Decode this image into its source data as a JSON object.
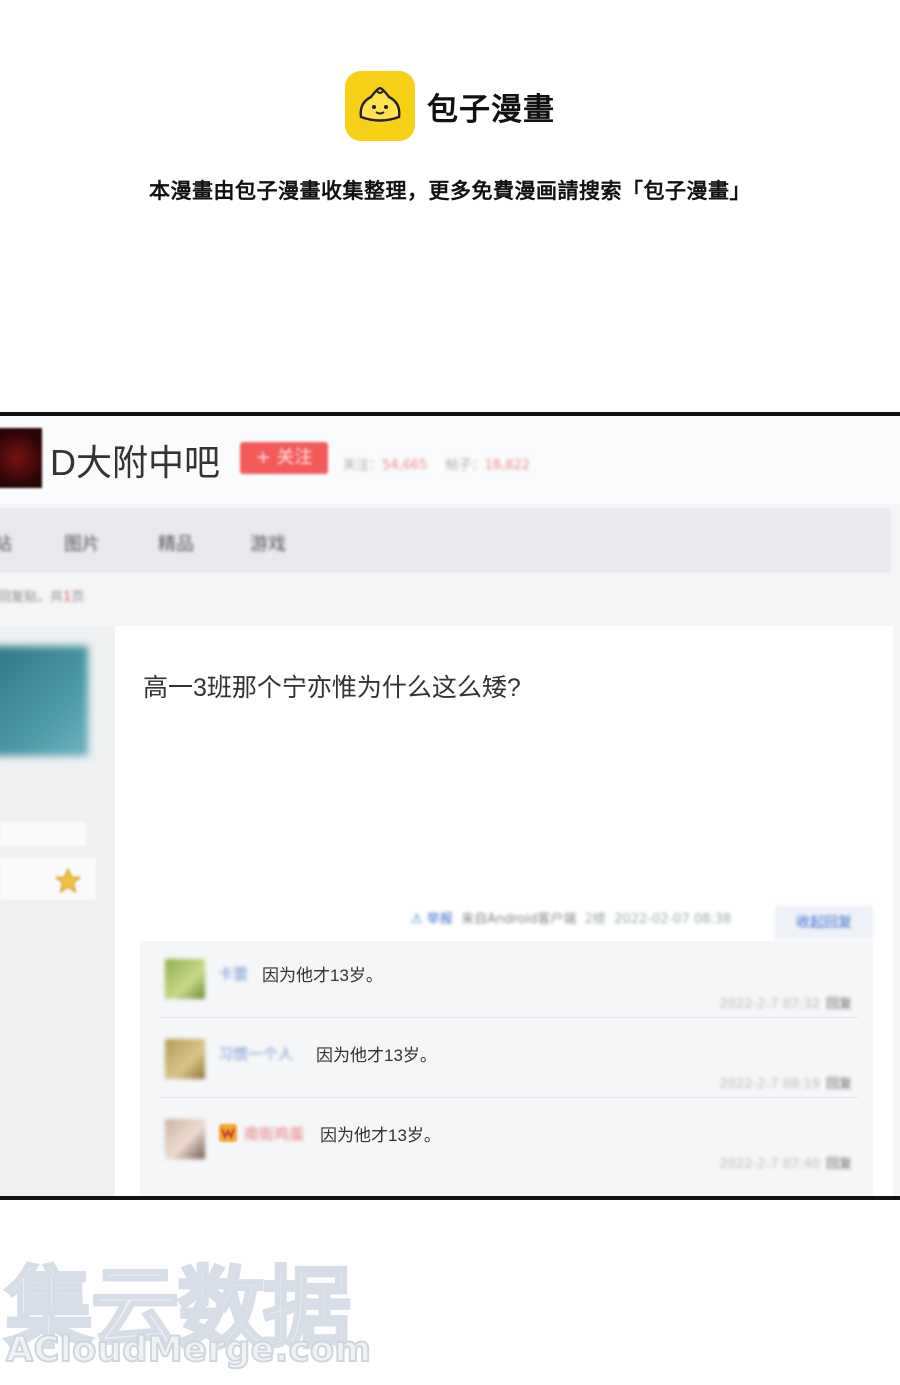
{
  "banner": {
    "brand_name": "包子漫畫",
    "notice": "本漫畫由包子漫畫收集整理，更多免費漫画請搜索「包子漫畫」"
  },
  "forum": {
    "name": "D大附中吧",
    "follow_label": "+ 关注",
    "followers_label": "关注：",
    "followers_value": "54,665",
    "posts_label": "帖子：",
    "posts_value": "18,822"
  },
  "nav": {
    "items": [
      "站",
      "图片",
      "精品",
      "游戏"
    ]
  },
  "breadcrumb": {
    "text_before": "回复贴，共",
    "page_count": "1",
    "text_after": "页"
  },
  "post": {
    "title": "高一3班那个宁亦惟为什么这么矮?",
    "report_label": "举报",
    "client": "来自Android客户端",
    "floor": "2楼",
    "time": "2022-02-07 08:38",
    "collapse_label": "收起回复"
  },
  "replies": [
    {
      "user": "卡蕾",
      "text": "因为他才13岁。",
      "time": "2022-2-7 07:32",
      "reply_label": "回复",
      "user_color": "#7a9ad6"
    },
    {
      "user": "习惯一个人",
      "text": "因为他才13岁。",
      "time": "2022-2-7 08:19",
      "reply_label": "回复",
      "user_color": "#7a9ad6"
    },
    {
      "user": "南街鸡蛋",
      "text": "因为他才13岁。",
      "time": "2022-2-7 07:40",
      "reply_label": "回复",
      "user_color": "#e77777"
    }
  ],
  "watermark": {
    "cn": "集云数据",
    "en": "ACloudMerge.com"
  },
  "colors": {
    "logo_yellow": "#f7d117",
    "follow_red": "#f35b5b",
    "link_blue": "#3a6fcf"
  },
  "icons": [
    "bun-logo-icon",
    "warning-icon",
    "star-badge-icon",
    "vip-badge-icon"
  ]
}
